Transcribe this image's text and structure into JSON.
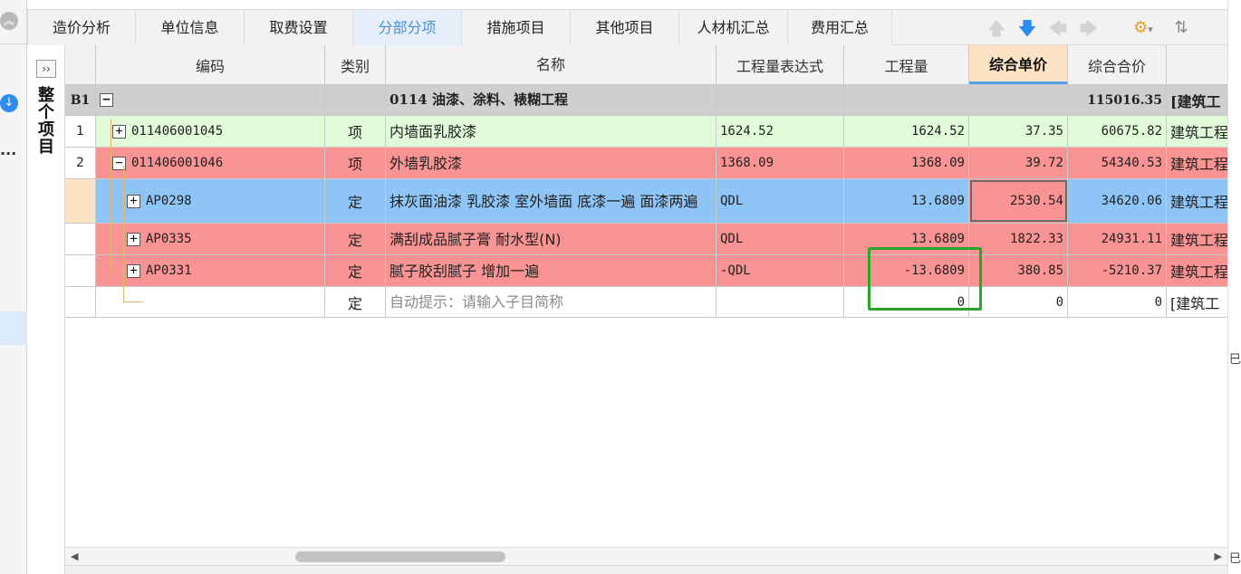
{
  "tabs": [
    {
      "label": "造价分析"
    },
    {
      "label": "单位信息"
    },
    {
      "label": "取费设置"
    },
    {
      "label": "分部分项"
    },
    {
      "label": "措施项目"
    },
    {
      "label": "其他项目"
    },
    {
      "label": "人材机汇总"
    },
    {
      "label": "费用汇总"
    }
  ],
  "active_tab": "分部分项",
  "toolbar_icons": [
    "arrow-up-icon",
    "arrow-down-icon",
    "arrow-left-icon",
    "arrow-right-icon",
    "settings-icon",
    "sort-icon"
  ],
  "side_panel": {
    "expand_glyph": "››",
    "label": "整个项目"
  },
  "left_rail": {
    "more": "..."
  },
  "columns": {
    "code": "编码",
    "type": "类别",
    "name": "名称",
    "expr": "工程量表达式",
    "qty": "工程量",
    "unit_price": "综合单价",
    "total": "综合合价"
  },
  "rows": [
    {
      "idx": "B1",
      "code": "",
      "type": "",
      "name": "0114  油漆、涂料、裱糊工程",
      "expr": "",
      "qty": "",
      "price": "",
      "total": "115016.35",
      "extra": "[建筑工"
    },
    {
      "idx": "1",
      "code": "011406001045",
      "type": "项",
      "name": "内墙面乳胶漆",
      "expr": "1624.52",
      "qty": "1624.52",
      "price": "37.35",
      "total": "60675.82",
      "extra": "建筑工程"
    },
    {
      "idx": "2",
      "code": "011406001046",
      "type": "项",
      "name": "外墙乳胶漆",
      "expr": "1368.09",
      "qty": "1368.09",
      "price": "39.72",
      "total": "54340.53",
      "extra": "建筑工程"
    },
    {
      "idx": "",
      "code": "AP0298",
      "type": "定",
      "name": "抹灰面油漆 乳胶漆 室外墙面 底漆一遍 面漆两遍",
      "expr": "QDL",
      "qty": "13.6809",
      "price": "2530.54",
      "total": "34620.06",
      "extra": "建筑工程"
    },
    {
      "idx": "",
      "code": "AP0335",
      "type": "定",
      "name": "满刮成品腻子膏 耐水型(N)",
      "expr": "QDL",
      "qty": "13.6809",
      "price": "1822.33",
      "total": "24931.11",
      "extra": "建筑工程"
    },
    {
      "idx": "",
      "code": "AP0331",
      "type": "定",
      "name": "腻子胶刮腻子 增加一遍",
      "expr": "-QDL",
      "qty": "-13.6809",
      "price": "380.85",
      "total": "-5210.37",
      "extra": "建筑工程"
    },
    {
      "idx": "",
      "code": "",
      "type": "定",
      "name": "自动提示：请输入子目简称",
      "expr": "",
      "qty": "0",
      "price": "0",
      "total": "0",
      "extra": "[建筑工"
    }
  ],
  "tree_glyphs": {
    "minus": "−",
    "plus": "+"
  },
  "scroll_glyphs": {
    "left": "◀",
    "right": "▶"
  },
  "right_edge_marks": [
    "巳",
    "巳"
  ],
  "colors": {
    "section_row": "#cfcfcf",
    "item_row_green": "#e1fad8",
    "item_row_red": "#fa9393",
    "selected_row_blue": "#8ec4f6",
    "active_tab_text": "#4a90d9",
    "highlight_box": "#2aa52a"
  }
}
